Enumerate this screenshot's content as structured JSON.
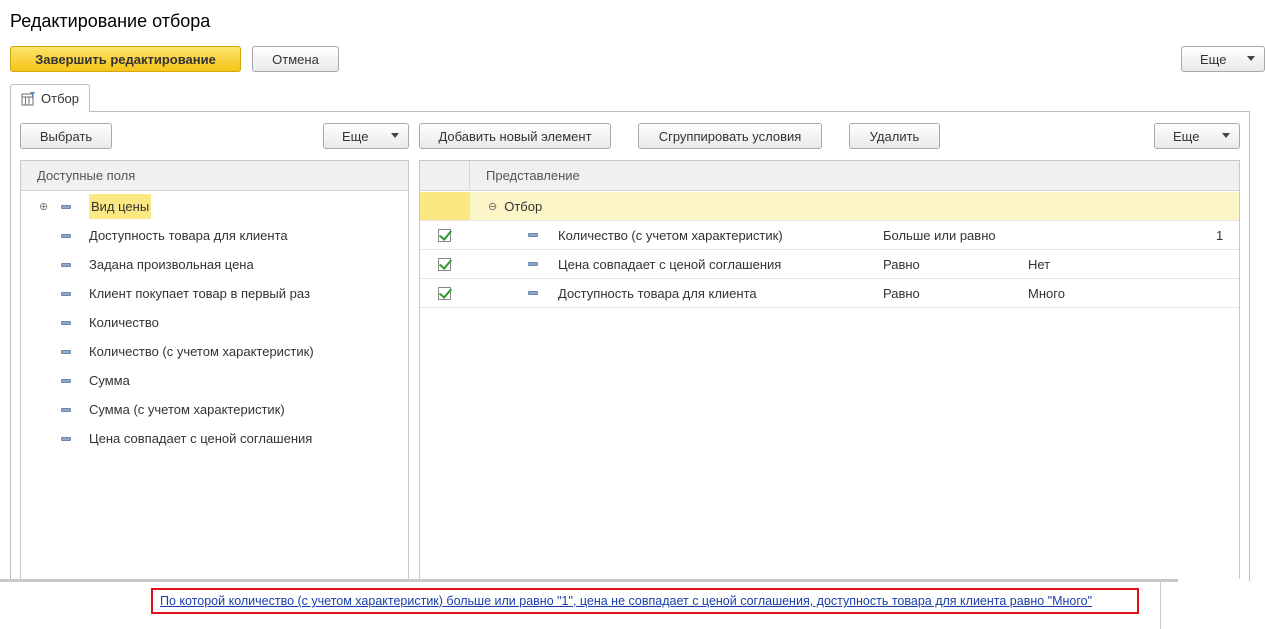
{
  "window": {
    "title": "Редактирование отбора"
  },
  "toolbar": {
    "finish_label": "Завершить редактирование",
    "cancel_label": "Отмена",
    "more_label": "Еще"
  },
  "tab": {
    "label": "Отбор",
    "icon": "filter-table-icon"
  },
  "left_panel": {
    "select_label": "Выбрать",
    "more_label": "Еще",
    "header": "Доступные поля",
    "items": [
      {
        "label": "Вид цены",
        "expandable": true,
        "selected": true
      },
      {
        "label": "Доступность товара для клиента"
      },
      {
        "label": "Задана произвольная цена"
      },
      {
        "label": "Клиент покупает товар в первый раз"
      },
      {
        "label": "Количество"
      },
      {
        "label": "Количество (с учетом характеристик)"
      },
      {
        "label": "Сумма"
      },
      {
        "label": "Сумма (с учетом характеристик)"
      },
      {
        "label": "Цена совпадает с ценой соглашения"
      }
    ]
  },
  "right_panel": {
    "add_label": "Добавить новый элемент",
    "group_label": "Сгруппировать условия",
    "delete_label": "Удалить",
    "more_label": "Еще",
    "header": "Представление",
    "group_row": "Отбор",
    "rows": [
      {
        "checked": true,
        "field": "Количество (с учетом характеристик)",
        "condition": "Больше или равно",
        "value": "",
        "value_right": "1"
      },
      {
        "checked": true,
        "field": "Цена совпадает с ценой соглашения",
        "condition": "Равно",
        "value": "Нет",
        "value_right": ""
      },
      {
        "checked": true,
        "field": "Доступность товара для клиента",
        "condition": "Равно",
        "value": "Много",
        "value_right": ""
      }
    ]
  },
  "summary": {
    "text": "По которой количество (с учетом характеристик) больше или равно \"1\", цена не совпадает с ценой соглашения, доступность товара для клиента равно \"Много\"",
    "highlight_color": "#e10f1a"
  },
  "colors": {
    "accent": "#f5c519",
    "selection": "#fce882",
    "link": "#1a3fa8"
  }
}
